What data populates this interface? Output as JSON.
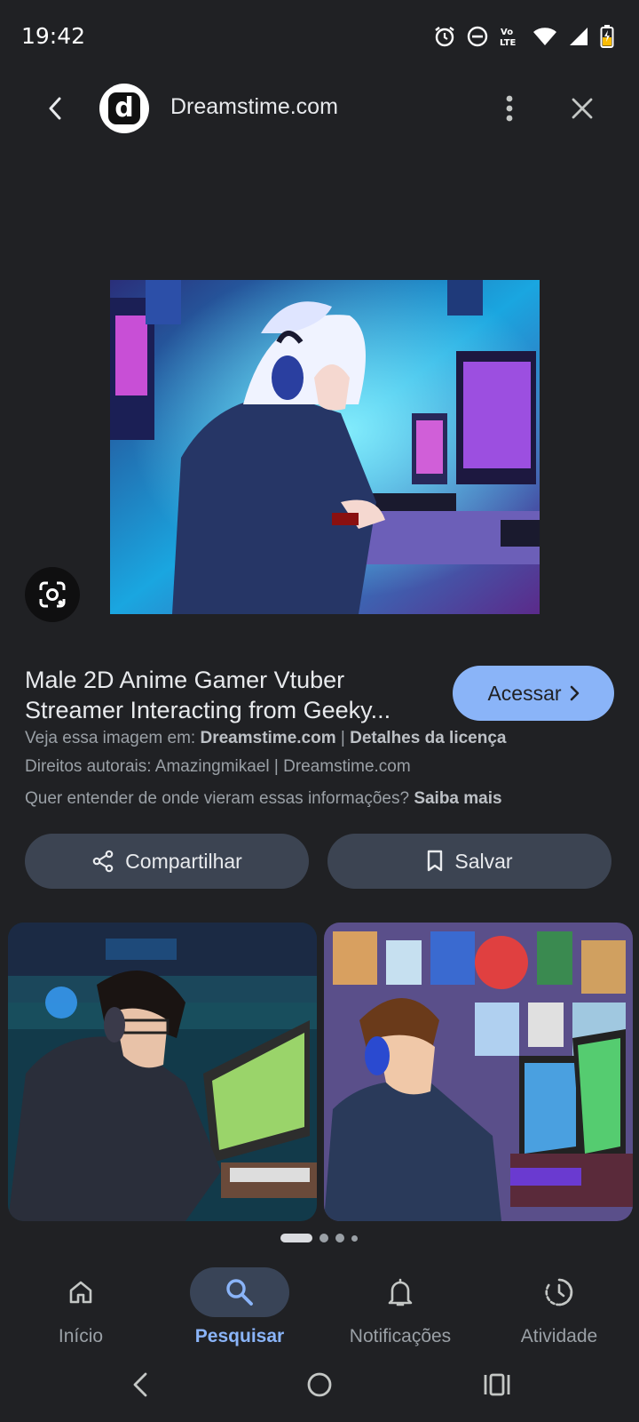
{
  "status_bar": {
    "time": "19:42",
    "icons": [
      "alarm-icon",
      "do-not-disturb-icon",
      "volte-icon",
      "wifi-icon",
      "signal-icon",
      "battery-charging-icon"
    ],
    "volte_text": "Vo LTE"
  },
  "header": {
    "site_logo_letter": "d",
    "site_name": "Dreamstime.com"
  },
  "result": {
    "title_line1": "Male 2D Anime Gamer Vtuber",
    "title_line2": "Streamer Interacting from Geeky...",
    "visit_label": "Acessar",
    "source_prefix": "Veja essa imagem em: ",
    "source_site": "Dreamstime.com",
    "source_sep": " | ",
    "license_link": "Detalhes da licença",
    "copyright": "Direitos autorais: Amazingmikael | Dreamstime.com",
    "learn_question": "Quer entender de onde vieram essas informações? ",
    "learn_link": "Saiba mais"
  },
  "actions": {
    "share_label": "Compartilhar",
    "save_label": "Salvar"
  },
  "bottom_nav": {
    "items": [
      {
        "label": "Início",
        "icon": "home-icon",
        "active": false
      },
      {
        "label": "Pesquisar",
        "icon": "search-icon",
        "active": true
      },
      {
        "label": "Notificações",
        "icon": "bell-icon",
        "active": false
      },
      {
        "label": "Atividade",
        "icon": "activity-icon",
        "active": false
      }
    ]
  },
  "colors": {
    "background": "#202124",
    "accent": "#8ab4f8",
    "button_bg": "#3c4452"
  }
}
